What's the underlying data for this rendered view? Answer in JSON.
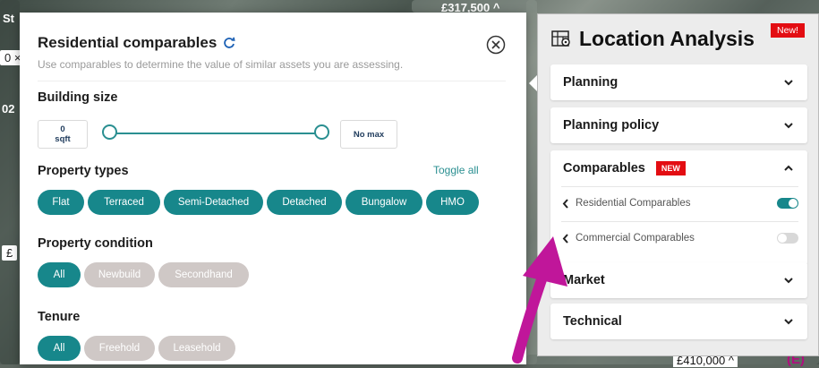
{
  "map": {
    "price_top": "£317,500 ^",
    "price_bottom": "£410,000 ^",
    "left_labels": [
      "0 ×",
      "St",
      "02",
      "£",
      "(E)"
    ]
  },
  "comparables": {
    "title": "Residential comparables",
    "subtitle": "Use comparables to determine the value of similar assets you are assessing.",
    "building_size": {
      "heading": "Building size",
      "min_value": "0",
      "min_unit": "sqft",
      "max_label": "No max"
    },
    "property_types": {
      "heading": "Property types",
      "toggle_all": "Toggle all",
      "chips": [
        {
          "label": "Flat",
          "active": true
        },
        {
          "label": "Terraced",
          "active": true
        },
        {
          "label": "Semi-Detached",
          "active": true
        },
        {
          "label": "Detached",
          "active": true
        },
        {
          "label": "Bungalow",
          "active": true
        },
        {
          "label": "HMO",
          "active": true
        }
      ]
    },
    "property_condition": {
      "heading": "Property condition",
      "chips": [
        {
          "label": "All",
          "active": true
        },
        {
          "label": "Newbuild",
          "active": false
        },
        {
          "label": "Secondhand",
          "active": false
        }
      ]
    },
    "tenure": {
      "heading": "Tenure",
      "chips": [
        {
          "label": "All",
          "active": true
        },
        {
          "label": "Freehold",
          "active": false
        },
        {
          "label": "Leasehold",
          "active": false
        }
      ]
    }
  },
  "location": {
    "title": "Location Analysis",
    "new_flag": "New!",
    "sections": {
      "planning": "Planning",
      "planning_policy": "Planning policy",
      "comparables": "Comparables",
      "comparables_badge": "NEW",
      "residential": "Residential Comparables",
      "residential_on": true,
      "commercial": "Commercial Comparables",
      "commercial_on": false,
      "market": "Market",
      "technical": "Technical"
    }
  },
  "colors": {
    "accent": "#17878b",
    "inactive_chip": "#cfc8c6",
    "badge_red": "#e30d12",
    "arrow_magenta": "#c0169a"
  }
}
